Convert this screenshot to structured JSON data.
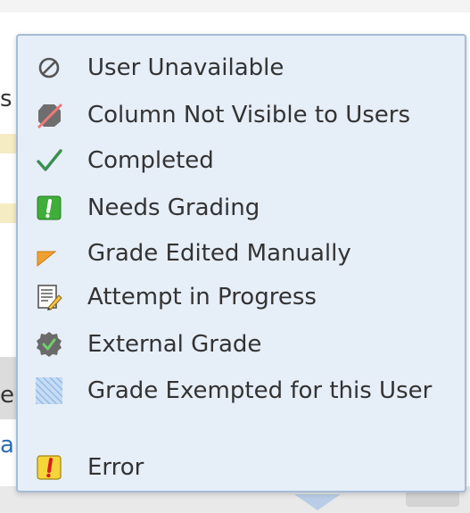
{
  "legend": {
    "items": [
      {
        "icon": "user-unavailable-icon",
        "label": "User Unavailable"
      },
      {
        "icon": "column-hidden-icon",
        "label": "Column Not Visible to Users"
      },
      {
        "icon": "checkmark-icon",
        "label": "Completed"
      },
      {
        "icon": "needs-grading-icon",
        "label": "Needs Grading"
      },
      {
        "icon": "grade-edited-flag-icon",
        "label": "Grade Edited Manually"
      },
      {
        "icon": "attempt-in-progress-icon",
        "label": "Attempt in Progress"
      },
      {
        "icon": "external-grade-icon",
        "label": "External Grade"
      },
      {
        "icon": "grade-exempted-icon",
        "label": "Grade Exempted for this User"
      },
      {
        "icon": "error-icon",
        "label": "Error"
      }
    ]
  },
  "background": {
    "fragments": [
      "s",
      "e",
      "a"
    ]
  }
}
